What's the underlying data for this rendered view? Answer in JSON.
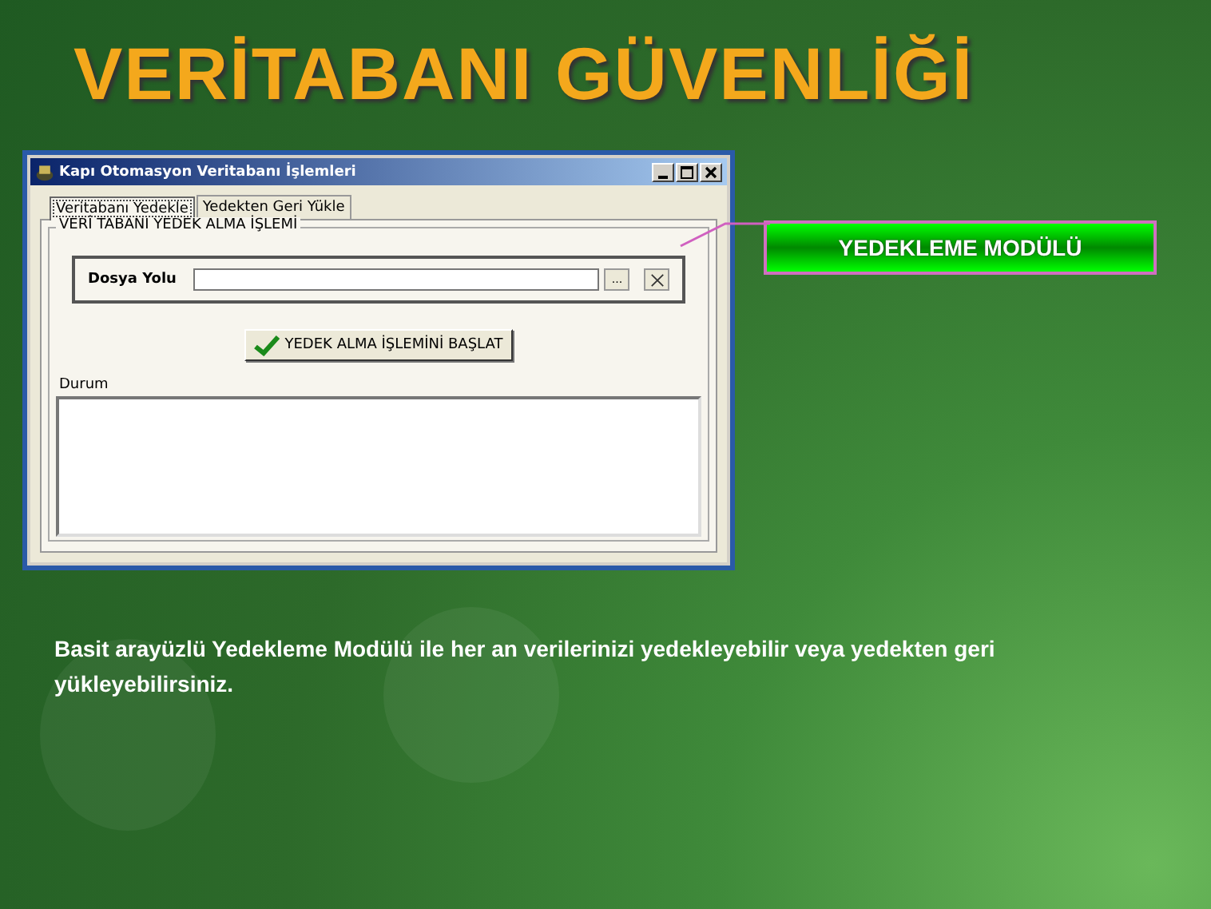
{
  "slide_title": "VERİTABANI GÜVENLİĞİ",
  "window": {
    "title": "Kapı Otomasyon Veritabanı İşlemleri",
    "tabs": [
      {
        "label": "Veritabanı Yedekle",
        "selected": true
      },
      {
        "label": "Yedekten Geri Yükle",
        "selected": false
      }
    ],
    "group_title": "VERİ TABANI YEDEK ALMA İŞLEMİ",
    "file_path": {
      "label": "Dosya Yolu",
      "browse_button": "..."
    },
    "start_button": "YEDEK ALMA İŞLEMİNİ BAŞLAT",
    "status_label": "Durum"
  },
  "callout": "YEDEKLEME MODÜLÜ",
  "caption": "Basit arayüzlü Yedekleme Modülü ile her an verilerinizi yedekleyebilir veya yedekten geri yükleyebilirsiniz."
}
